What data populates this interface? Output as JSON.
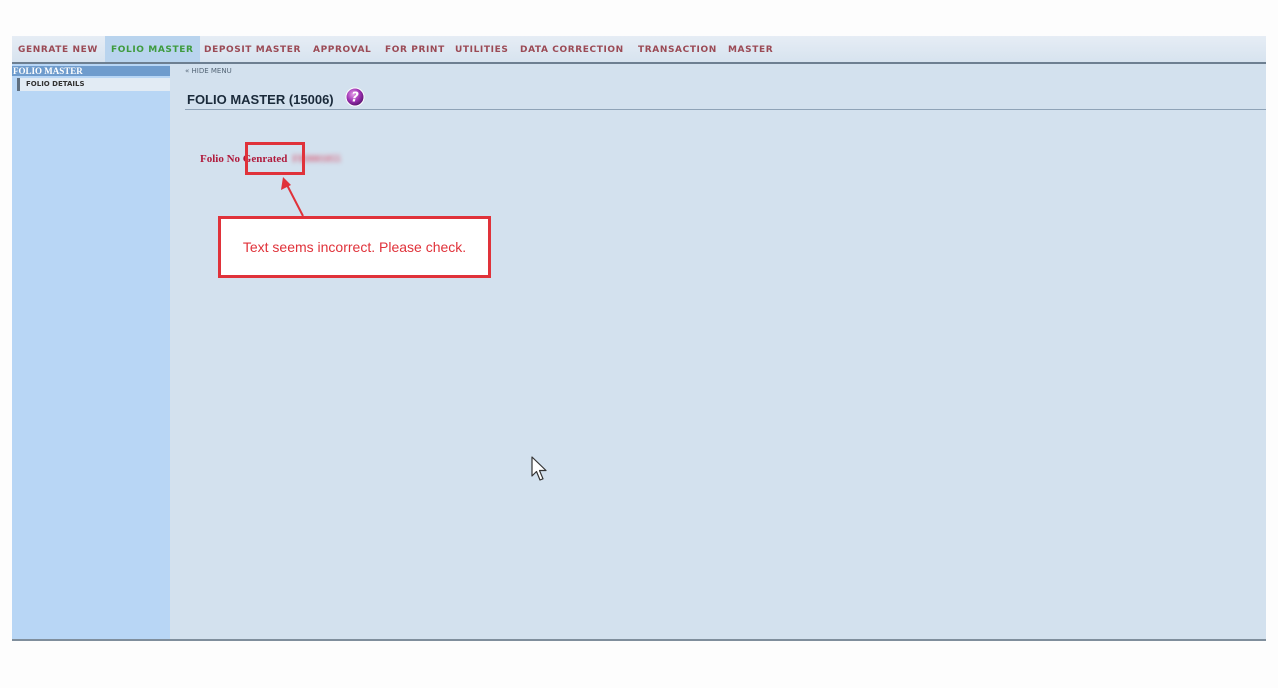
{
  "menu": {
    "items": [
      {
        "label": "GENRATE NEW"
      },
      {
        "label": "FOLIO MASTER"
      },
      {
        "label": "DEPOSIT MASTER"
      },
      {
        "label": "APPROVAL"
      },
      {
        "label": "FOR PRINT"
      },
      {
        "label": "UTILITIES"
      },
      {
        "label": "DATA CORRECTION"
      },
      {
        "label": "TRANSACTION"
      },
      {
        "label": "MASTER"
      }
    ],
    "active": "FOLIO MASTER"
  },
  "sidebar": {
    "header": "FOLIO MASTER",
    "items": [
      {
        "label": "FOLIO DETAILS"
      }
    ]
  },
  "content": {
    "hide_menu": "« HIDE MENU",
    "title": "FOLIO MASTER (15006)",
    "folio_label": "Folio No Genrated",
    "folio_value": "FR0001055"
  },
  "annotation": {
    "callout_text": "Text seems incorrect. Please check.",
    "color": "#e0323a"
  },
  "icons": {
    "help": "help-icon",
    "cursor": "mouse-pointer-icon"
  }
}
